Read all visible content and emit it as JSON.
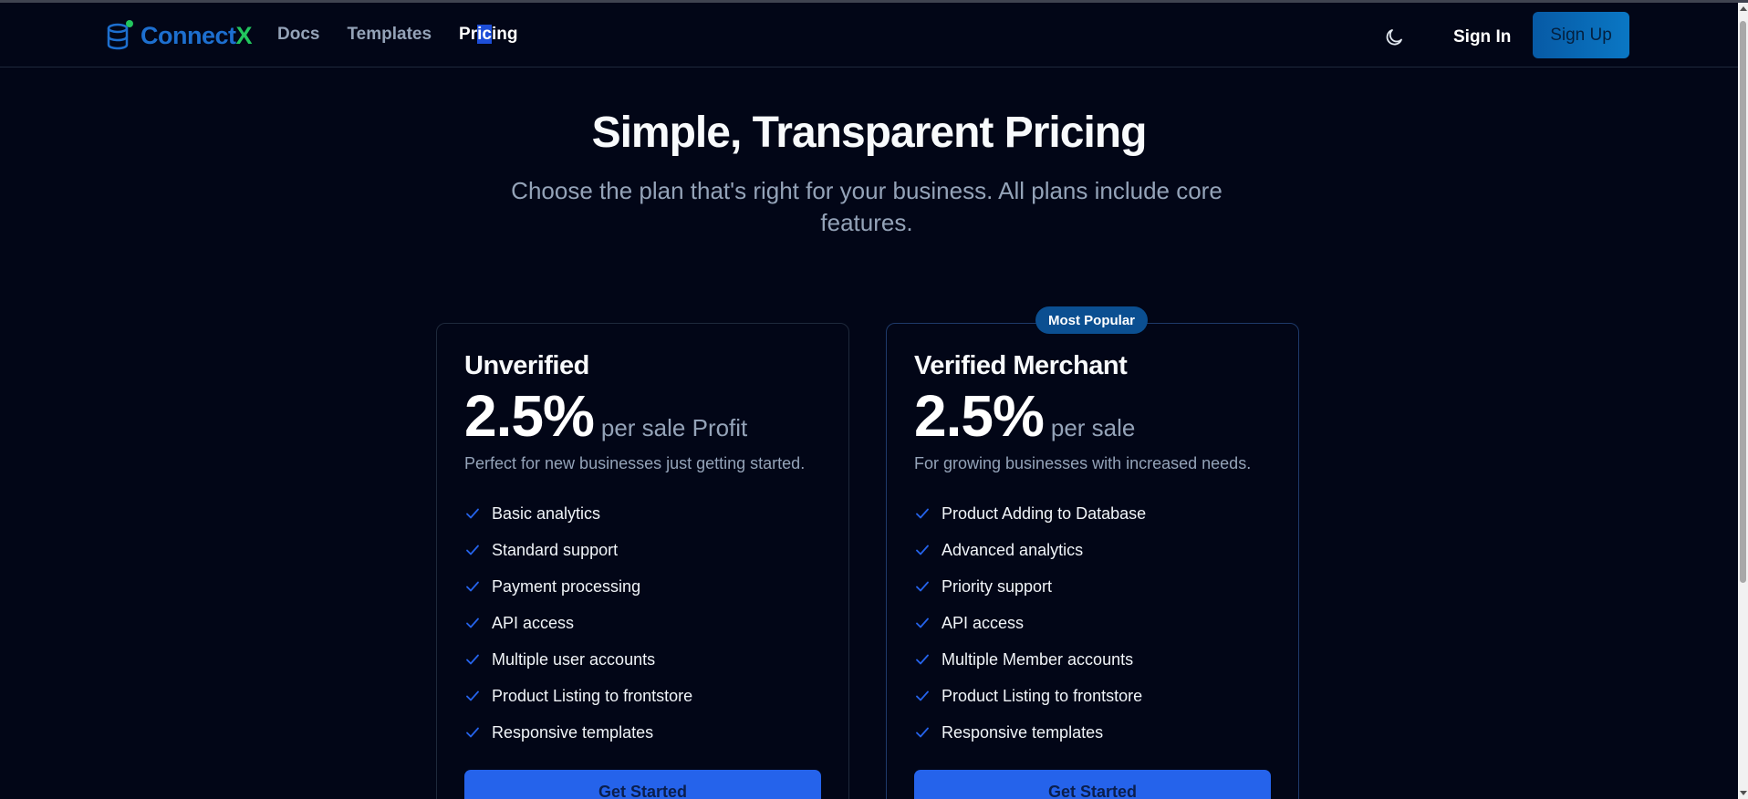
{
  "brand": {
    "name_main": "Connect",
    "name_accent": "X",
    "icon": "database-icon"
  },
  "nav": {
    "items": [
      {
        "label": "Docs"
      },
      {
        "label": "Templates"
      },
      {
        "label": "Pricing",
        "active": true
      }
    ]
  },
  "header": {
    "theme_toggle_icon": "moon-icon",
    "signin_label": "Sign In",
    "signup_label": "Sign Up"
  },
  "hero": {
    "title": "Simple, Transparent Pricing",
    "subtitle": "Choose the plan that's right for your business. All plans include core features."
  },
  "plans": [
    {
      "name": "Unverified",
      "price": "2.5%",
      "per": "per sale Profit",
      "description": "Perfect for new businesses just getting started.",
      "features": [
        "Basic analytics",
        "Standard support",
        "Payment processing",
        "API access",
        "Multiple user accounts",
        "Product Listing to frontstore",
        "Responsive templates"
      ],
      "cta": "Get Started"
    },
    {
      "name": "Verified Merchant",
      "badge": "Most Popular",
      "price": "2.5%",
      "per": "per sale",
      "description": "For growing businesses with increased needs.",
      "features": [
        "Product Adding to Database",
        "Advanced analytics",
        "Priority support",
        "API access",
        "Multiple Member accounts",
        "Product Listing to frontstore",
        "Responsive templates"
      ],
      "cta": "Get Started"
    }
  ],
  "colors": {
    "background": "#020617",
    "accent": "#2563eb",
    "brand_blue": "#1d6fcf",
    "brand_green": "#22c55e",
    "check": "#2563eb"
  }
}
